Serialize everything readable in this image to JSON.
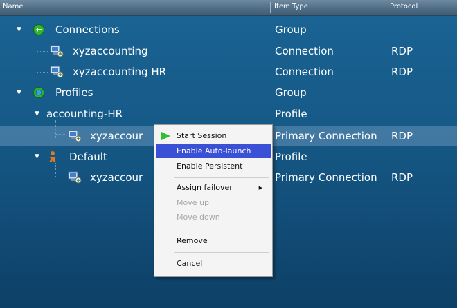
{
  "header": {
    "columns": [
      {
        "label": "Name"
      },
      {
        "label": "Item Type"
      },
      {
        "label": "Protocol"
      }
    ]
  },
  "tree": {
    "rows": [
      {
        "name": "Connections",
        "type": "Group",
        "protocol": "",
        "icon": "connections-group-icon"
      },
      {
        "name": "xyzaccounting",
        "type": "Connection",
        "protocol": "RDP",
        "icon": "computer-connection-icon"
      },
      {
        "name": "xyzaccounting HR",
        "type": "Connection",
        "protocol": "RDP",
        "icon": "computer-connection-icon"
      },
      {
        "name": "Profiles",
        "type": "Group",
        "protocol": "",
        "icon": "profiles-group-icon"
      },
      {
        "name": "accounting-HR",
        "type": "Profile",
        "protocol": "",
        "icon": ""
      },
      {
        "name": "xyzaccour",
        "type": "Primary Connection",
        "protocol": "RDP",
        "icon": "computer-connection-icon",
        "selected": true
      },
      {
        "name": "Default",
        "type": "Profile",
        "protocol": "",
        "icon": "person-profile-icon"
      },
      {
        "name": "xyzaccour",
        "type": "Primary Connection",
        "protocol": "RDP",
        "icon": "computer-connection-icon"
      }
    ]
  },
  "context_menu": {
    "items": [
      {
        "label": "Start Session",
        "icon": "green-play-icon"
      },
      {
        "label": "Enable Auto-launch",
        "highlighted": true
      },
      {
        "label": "Enable Persistent"
      },
      {
        "label": "Assign failover",
        "submenu": true
      },
      {
        "label": "Move up",
        "disabled": true
      },
      {
        "label": "Move down",
        "disabled": true
      },
      {
        "label": "Remove"
      },
      {
        "label": "Cancel"
      }
    ]
  },
  "colors": {
    "background": "#165a88",
    "menu_highlight": "#3a51d6",
    "selected_row": "#6f9cc0"
  }
}
